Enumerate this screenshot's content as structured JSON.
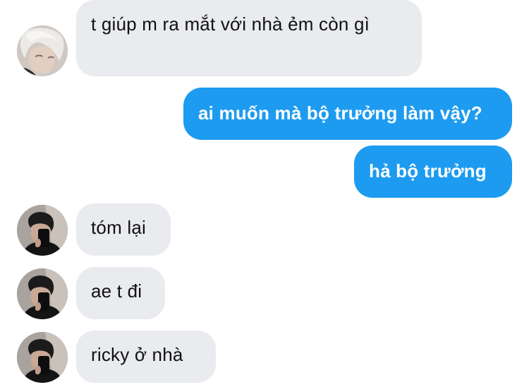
{
  "conversation": {
    "messages": [
      {
        "direction": "incoming",
        "sender_avatar": "avatar-silver-hair",
        "text": "t giúp m ra mắt với nhà ẻm còn gì"
      },
      {
        "direction": "outgoing",
        "text": "ai muốn mà bộ trưởng làm vậy?"
      },
      {
        "direction": "outgoing",
        "text": "hả bộ trưởng"
      },
      {
        "direction": "incoming",
        "sender_avatar": "avatar-mirror-selfie",
        "text": "tóm lại"
      },
      {
        "direction": "incoming",
        "sender_avatar": "avatar-mirror-selfie",
        "text": "ae t đi"
      },
      {
        "direction": "incoming",
        "sender_avatar": "avatar-mirror-selfie",
        "text": "ricky ở nhà"
      }
    ]
  },
  "colors": {
    "incoming_bubble": "#e9ebef",
    "outgoing_bubble": "#1d9bf0",
    "incoming_text": "#111111",
    "outgoing_text": "#ffffff"
  }
}
